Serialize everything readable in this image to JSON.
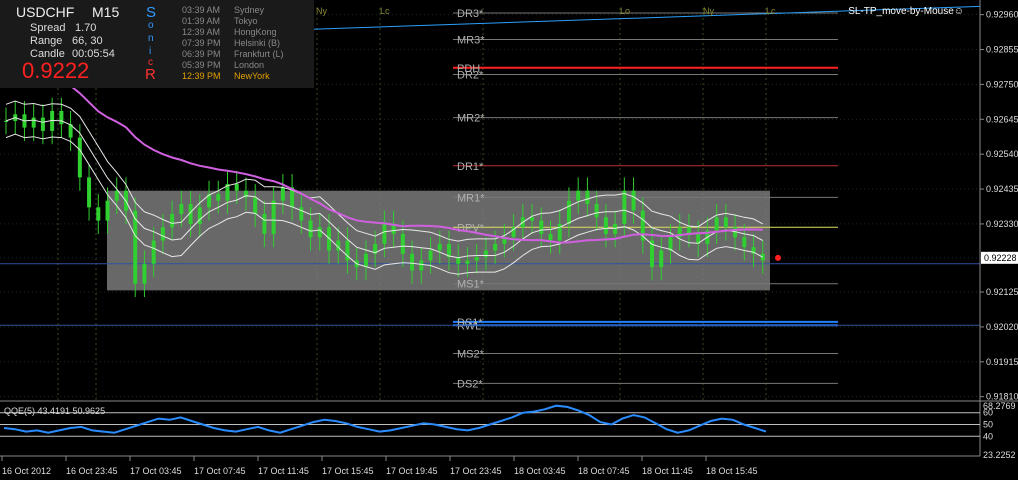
{
  "header": {
    "symbol": "USDCHF",
    "timeframe": "M15",
    "spread_label": "Spread",
    "spread_value": "1.70",
    "range_label": "Range",
    "range_value": "66, 30",
    "candle_label": "Candle",
    "candle_value": "00:05:54",
    "price": "0.9222",
    "side_letters": [
      "S",
      "o",
      "n",
      "i",
      "c",
      "R"
    ],
    "sessions": [
      {
        "time": "03:39 AM",
        "name": "Sydney",
        "color": "#888888"
      },
      {
        "time": "01:39 AM",
        "name": "Tokyo",
        "color": "#888888"
      },
      {
        "time": "12:39 AM",
        "name": "HongKong",
        "color": "#888888"
      },
      {
        "time": "07:39 PM",
        "name": "Helsinki  (B)",
        "color": "#888888"
      },
      {
        "time": "06:39 PM",
        "name": "Frankfurt  (L)",
        "color": "#888888"
      },
      {
        "time": "05:39 PM",
        "name": "London",
        "color": "#888888"
      },
      {
        "time": "12:39 PM",
        "name": "NewYork",
        "color": "#e0a000"
      }
    ],
    "ea_label": "SL-TP_move-by-Mouse☺"
  },
  "chart_data": {
    "type": "candlestick",
    "title": "USDCHF M15",
    "ylim": [
      0.918,
      0.9298
    ],
    "y_ticks": [
      "0.92960",
      "0.92855",
      "0.92750",
      "0.92645",
      "0.92540",
      "0.92435",
      "0.92330",
      "0.92228",
      "0.92125",
      "0.92020",
      "0.91915",
      "0.91810"
    ],
    "current_price_label": "0.92228",
    "x_ticks": [
      "16 Oct 2012",
      "16 Oct 23:45",
      "17 Oct 03:45",
      "17 Oct 07:45",
      "17 Oct 11:45",
      "17 Oct 15:45",
      "17 Oct 19:45",
      "17 Oct 23:45",
      "18 Oct 03:45",
      "18 Oct 07:45",
      "18 Oct 11:45",
      "18 Oct 15:45"
    ],
    "session_markers": [
      "Ny",
      "Lc",
      "Lo",
      "Ny",
      "Lc"
    ],
    "closes": [
      0.9264,
      0.9266,
      0.9262,
      0.9265,
      0.9261,
      0.9267,
      0.9263,
      0.9259,
      0.9247,
      0.9238,
      0.9234,
      0.924,
      0.9243,
      0.9237,
      0.9215,
      0.9221,
      0.9228,
      0.9232,
      0.9236,
      0.9239,
      0.9233,
      0.9238,
      0.9242,
      0.924,
      0.9245,
      0.9243,
      0.9241,
      0.9236,
      0.923,
      0.924,
      0.9244,
      0.9238,
      0.9234,
      0.9229,
      0.9232,
      0.9225,
      0.9228,
      0.9222,
      0.922,
      0.9224,
      0.9227,
      0.9233,
      0.923,
      0.9224,
      0.9219,
      0.9222,
      0.9225,
      0.9227,
      0.9223,
      0.9221,
      0.9222,
      0.9223,
      0.9225,
      0.9227,
      0.9229,
      0.9232,
      0.9235,
      0.9234,
      0.923,
      0.9228,
      0.9233,
      0.924,
      0.9243,
      0.9239,
      0.9235,
      0.923,
      0.9233,
      0.9243,
      0.9237,
      0.9228,
      0.922,
      0.9225,
      0.9229,
      0.9232,
      0.923,
      0.9227,
      0.9231,
      0.9235,
      0.9232,
      0.9229,
      0.9226,
      0.9224,
      0.9222
    ],
    "levels": [
      {
        "name": "DR3*",
        "value": 0.92965,
        "color": "#777777"
      },
      {
        "name": "MR3*",
        "value": 0.92885,
        "color": "#777777"
      },
      {
        "name": "PDH",
        "value": 0.928,
        "color": "#ff2020"
      },
      {
        "name": "DR2*",
        "value": 0.9278,
        "color": "#777777"
      },
      {
        "name": "MR2*",
        "value": 0.9265,
        "color": "#777777"
      },
      {
        "name": "DR1*",
        "value": 0.92505,
        "color": "#c03030"
      },
      {
        "name": "MR1*",
        "value": 0.9241,
        "color": "#777777"
      },
      {
        "name": "DPV*",
        "value": 0.9232,
        "color": "#e0e060"
      },
      {
        "name": "MS1*",
        "value": 0.9215,
        "color": "#777777"
      },
      {
        "name": "DS1*",
        "value": 0.92035,
        "color": "#2080ff"
      },
      {
        "name": "RWL",
        "value": 0.92025,
        "color": "#2080ff"
      },
      {
        "name": "MS2*",
        "value": 0.9194,
        "color": "#777777"
      },
      {
        "name": "DS2*",
        "value": 0.9185,
        "color": "#777777"
      }
    ],
    "range_box": {
      "high": 0.9243,
      "low": 0.9213
    },
    "qqe": {
      "label": "QQE(5) 43.4191 50.9625",
      "ylim": [
        23.2252,
        68.2769
      ],
      "y_ticks": [
        "68.2769",
        "60",
        "50",
        "40",
        "23.2252"
      ],
      "values": [
        47,
        46,
        44,
        45,
        43,
        45,
        47,
        48,
        45,
        44,
        43,
        46,
        49,
        52,
        55,
        54,
        56,
        53,
        50,
        47,
        45,
        44,
        46,
        48,
        45,
        43,
        46,
        49,
        52,
        54,
        53,
        51,
        48,
        46,
        44,
        45,
        47,
        49,
        51,
        50,
        48,
        46,
        45,
        47,
        50,
        53,
        56,
        60,
        61,
        63,
        66,
        65,
        62,
        58,
        52,
        50,
        55,
        58,
        56,
        51,
        46,
        43,
        45,
        49,
        53,
        55,
        54,
        50,
        47,
        44
      ]
    }
  }
}
